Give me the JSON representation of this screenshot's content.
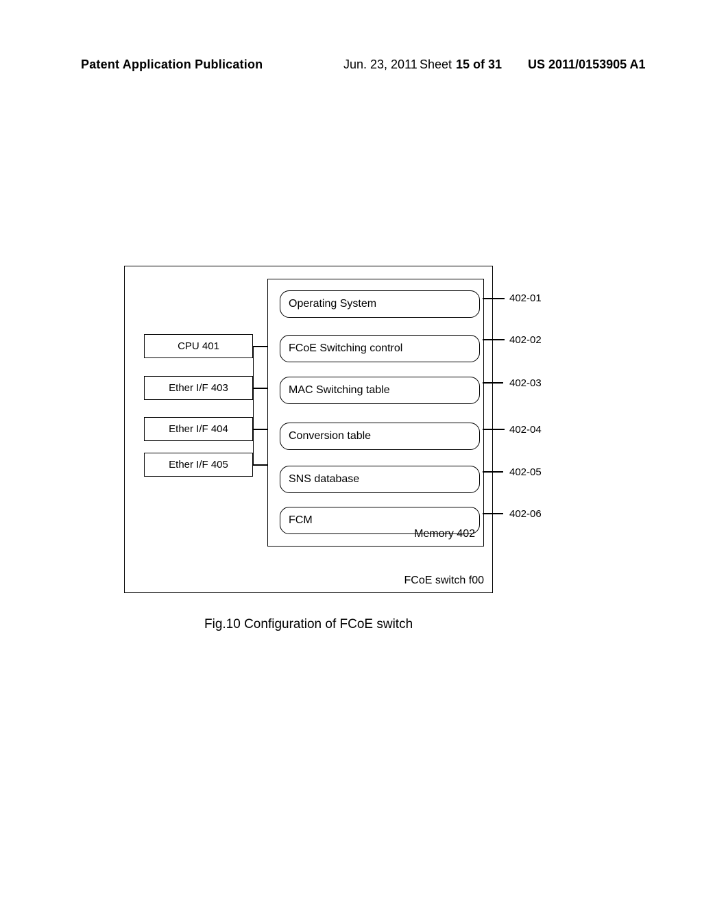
{
  "header": {
    "left": "Patent Application Publication",
    "date": "Jun. 23, 2011",
    "sheet_prefix": "Sheet ",
    "sheet": "15 of 31",
    "pubno": "US 2011/0153905 A1"
  },
  "outer_label": "FCoE switch f00",
  "memory_label": "Memory 402",
  "left_boxes": {
    "cpu": "CPU 401",
    "e1": "Ether I/F 403",
    "e2": "Ether I/F 404",
    "e3": "Ether I/F 405"
  },
  "pills": {
    "p1": "Operating System",
    "p2": "FCoE Switching control",
    "p3": "MAC Switching table",
    "p4": "Conversion table",
    "p5": "SNS database",
    "p6": "FCM"
  },
  "callouts": {
    "c1": "402-01",
    "c2": "402-02",
    "c3": "402-03",
    "c4": "402-04",
    "c5": "402-05",
    "c6": "402-06"
  },
  "caption": "Fig.10 Configuration of FCoE switch"
}
